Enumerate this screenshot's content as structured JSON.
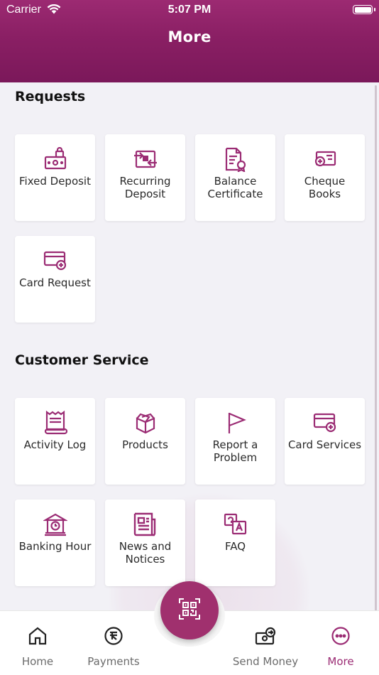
{
  "status_bar": {
    "carrier": "Carrier",
    "time": "5:07 PM"
  },
  "header": {
    "title": "More"
  },
  "sections": {
    "requests": {
      "title": "Requests",
      "items": [
        {
          "label": "Fixed Deposit",
          "icon": "fixed-deposit-icon"
        },
        {
          "label": "Recurring Deposit",
          "icon": "recurring-deposit-icon"
        },
        {
          "label": "Balance Certificate",
          "icon": "balance-certificate-icon"
        },
        {
          "label": "Cheque Books",
          "icon": "cheque-book-icon"
        },
        {
          "label": "Card Request",
          "icon": "card-request-icon"
        }
      ]
    },
    "customer_service": {
      "title": "Customer Service",
      "items": [
        {
          "label": "Activity Log",
          "icon": "activity-log-icon"
        },
        {
          "label": "Products",
          "icon": "box-icon"
        },
        {
          "label": "Report a Problem",
          "icon": "flag-icon"
        },
        {
          "label": "Card Services",
          "icon": "card-services-icon"
        },
        {
          "label": "Banking Hour",
          "icon": "bank-clock-icon"
        },
        {
          "label": "News and Notices",
          "icon": "newspaper-icon"
        },
        {
          "label": "FAQ",
          "icon": "faq-icon"
        }
      ]
    }
  },
  "tabbar": {
    "home": "Home",
    "payments": "Payments",
    "send_money": "Send Money",
    "more": "More",
    "active": "more"
  },
  "fab": {
    "icon": "qr-code-icon"
  },
  "colors": {
    "brand": "#9b2c74",
    "header": "#8a1f64",
    "text": "#2a2a2a",
    "tab_inactive": "#6b6b6b"
  }
}
